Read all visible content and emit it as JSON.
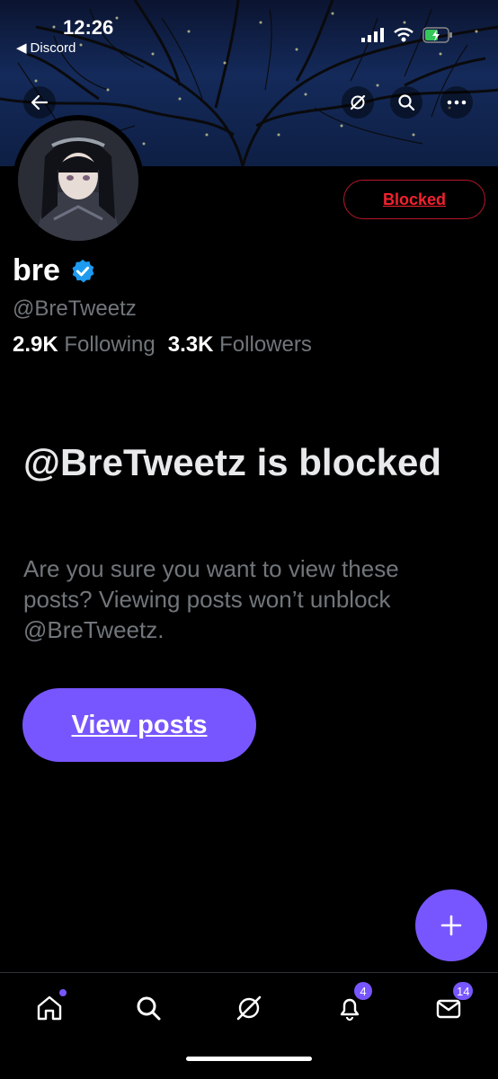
{
  "status_bar": {
    "time": "12:26",
    "back_app": "Discord"
  },
  "profile": {
    "name": "bre",
    "handle": "@BreTweetz",
    "following_count": "2.9K",
    "following_label": "Following",
    "followers_count": "3.3K",
    "followers_label": "Followers",
    "blocked_button": "Blocked"
  },
  "blocked_notice": {
    "title": "@BreTweetz is blocked",
    "description": "Are you sure you want to view these posts? Viewing posts won’t unblock @BreTweetz.",
    "view_button": "View posts"
  },
  "tabbar": {
    "notifications_badge": "4",
    "messages_badge": "14"
  },
  "colors": {
    "accent": "#7856ff",
    "blocked": "#f4212e",
    "verified": "#1d9bf0"
  },
  "icons": [
    "back-arrow-icon",
    "grok-icon",
    "search-icon",
    "more-icon",
    "verified-icon",
    "plus-icon",
    "home-icon",
    "explore-icon",
    "notifications-icon",
    "messages-icon"
  ]
}
